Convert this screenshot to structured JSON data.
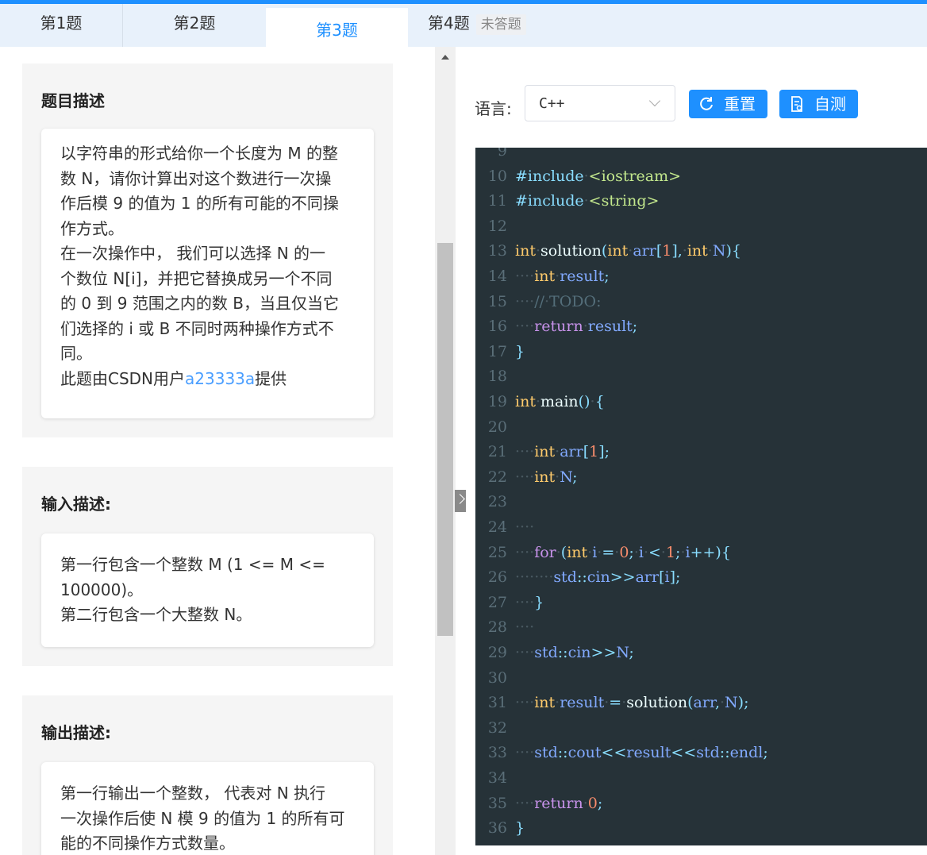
{
  "tabs": [
    {
      "label": "第1题"
    },
    {
      "label": "第2题"
    },
    {
      "label": "第3题",
      "active": true
    },
    {
      "label": "第4题",
      "badge": "未答题"
    }
  ],
  "description": {
    "title": "题目描述",
    "lines": [
      "以字符串的形式给你一个长度为 M 的整",
      "数 N，请你计算出对这个数进行一次操",
      "作后模 9 的值为 1 的所有可能的不同操",
      "作方式。",
      "在一次操作中， 我们可以选择 N 的一",
      "个数位 N[i]，并把它替换成另一个不同",
      "的 0 到 9 范围之内的数 B，当且仅当它",
      "们选择的 i 或 B 不同时两种操作方式不",
      "同。"
    ],
    "credit_prefix": "此题由CSDN用户",
    "credit_user": "a23333a",
    "credit_suffix": "提供"
  },
  "input": {
    "title": "输入描述:",
    "lines": [
      "第一行包含一个整数 M (1 <= M <=",
      "100000)。",
      "第二行包含一个大整数 N。"
    ]
  },
  "output": {
    "title": "输出描述:",
    "lines": [
      "第一行输出一个整数， 代表对 N 执行",
      "一次操作后使 N 模 9 的值为 1 的所有可",
      "能的不同操作方式数量。"
    ]
  },
  "toolbar": {
    "language_label": "语言:",
    "language_value": "C++",
    "reset_label": "重置",
    "test_label": "自测"
  },
  "colors": {
    "accent": "#1e90ff",
    "editor_bg": "#263238"
  },
  "code": {
    "lines": [
      {
        "n": "9",
        "text": ""
      },
      {
        "n": "10",
        "text": "#include <iostream>"
      },
      {
        "n": "11",
        "text": "#include <string>"
      },
      {
        "n": "12",
        "text": ""
      },
      {
        "n": "13",
        "text": "int solution(int arr[1], int N){"
      },
      {
        "n": "14",
        "text": "    int result;"
      },
      {
        "n": "15",
        "text": "    // TODO:"
      },
      {
        "n": "16",
        "text": "    return result;"
      },
      {
        "n": "17",
        "text": "}"
      },
      {
        "n": "18",
        "text": ""
      },
      {
        "n": "19",
        "text": "int main() {"
      },
      {
        "n": "20",
        "text": ""
      },
      {
        "n": "21",
        "text": "    int arr[1];"
      },
      {
        "n": "22",
        "text": "    int N;"
      },
      {
        "n": "23",
        "text": ""
      },
      {
        "n": "24",
        "text": "    "
      },
      {
        "n": "25",
        "text": "    for (int i = 0; i < 1; i++){"
      },
      {
        "n": "26",
        "text": "        std::cin>>arr[i];"
      },
      {
        "n": "27",
        "text": "    }"
      },
      {
        "n": "28",
        "text": "    "
      },
      {
        "n": "29",
        "text": "    std::cin>>N;"
      },
      {
        "n": "30",
        "text": ""
      },
      {
        "n": "31",
        "text": "    int result = solution(arr, N);"
      },
      {
        "n": "32",
        "text": ""
      },
      {
        "n": "33",
        "text": "    std::cout<<result<<std::endl;"
      },
      {
        "n": "34",
        "text": ""
      },
      {
        "n": "35",
        "text": "    return 0;"
      },
      {
        "n": "36",
        "text": "}"
      }
    ]
  }
}
